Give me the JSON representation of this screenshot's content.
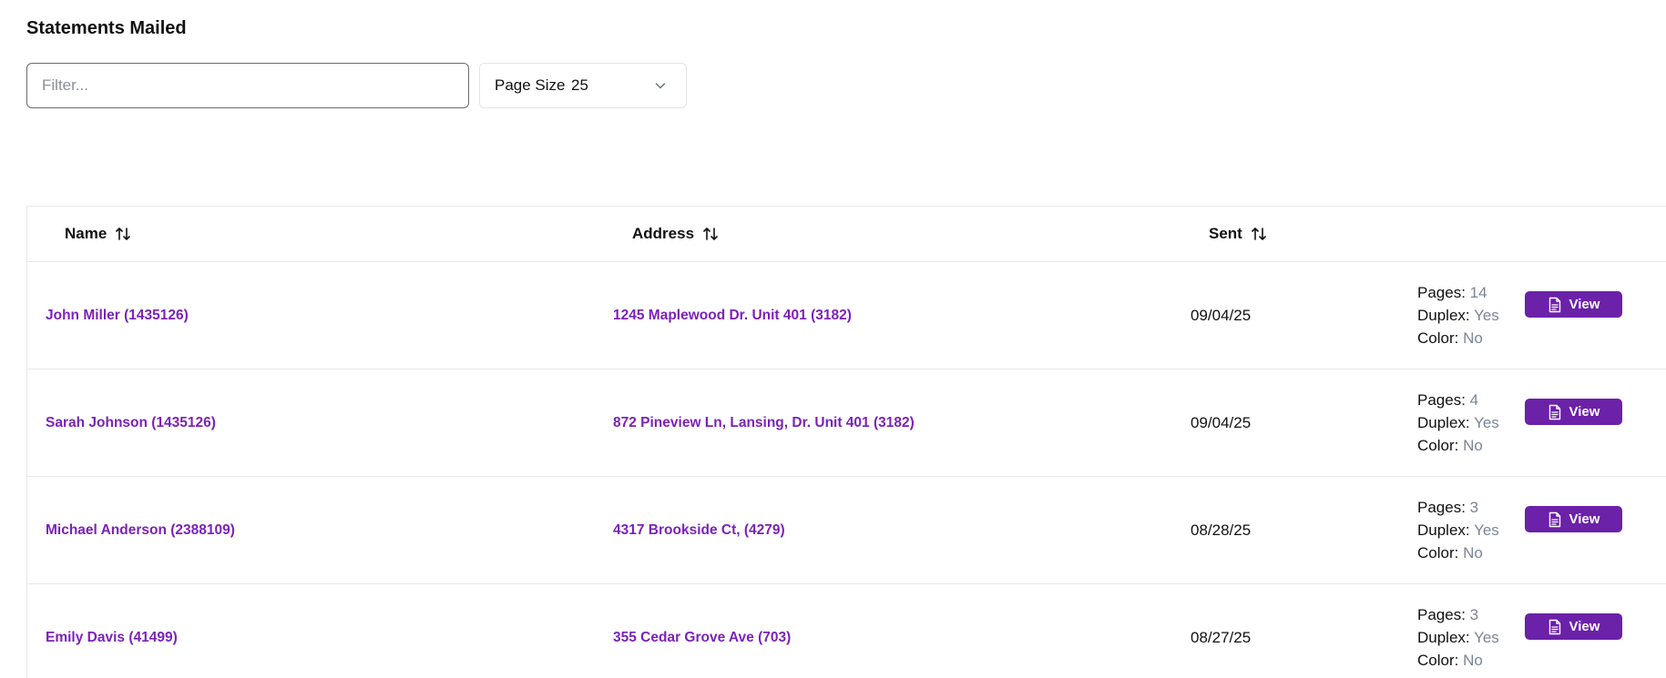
{
  "page": {
    "title": "Statements Mailed"
  },
  "filter": {
    "placeholder": "Filter...",
    "value": ""
  },
  "page_size": {
    "label": "Page Size",
    "value": "25"
  },
  "table": {
    "columns": {
      "name": "Name",
      "address": "Address",
      "sent": "Sent"
    },
    "meta_labels": {
      "pages": "Pages:",
      "duplex": "Duplex:",
      "color": "Color:"
    },
    "view_label": "View",
    "rows": [
      {
        "name": "John Miller (1435126)",
        "address": "1245 Maplewood Dr. Unit 401 (3182)",
        "sent": "09/04/25",
        "pages": "14",
        "duplex": "Yes",
        "color": "No"
      },
      {
        "name": "Sarah Johnson (1435126)",
        "address": "872 Pineview Ln, Lansing, Dr. Unit 401 (3182)",
        "sent": "09/04/25",
        "pages": "4",
        "duplex": "Yes",
        "color": "No"
      },
      {
        "name": "Michael Anderson (2388109)",
        "address": "4317 Brookside Ct, (4279)",
        "sent": "08/28/25",
        "pages": "3",
        "duplex": "Yes",
        "color": "No"
      },
      {
        "name": "Emily Davis (41499)",
        "address": "355 Cedar Grove Ave (703)",
        "sent": "08/27/25",
        "pages": "3",
        "duplex": "Yes",
        "color": "No"
      }
    ]
  },
  "colors": {
    "accent": "#6b21a8",
    "link": "#7b22b8",
    "muted_value": "#7b8594",
    "border": "#e5e7eb"
  },
  "icons": {
    "sort": "sort-arrows-icon",
    "view": "document-icon",
    "dropdown": "chevron-down-icon"
  }
}
